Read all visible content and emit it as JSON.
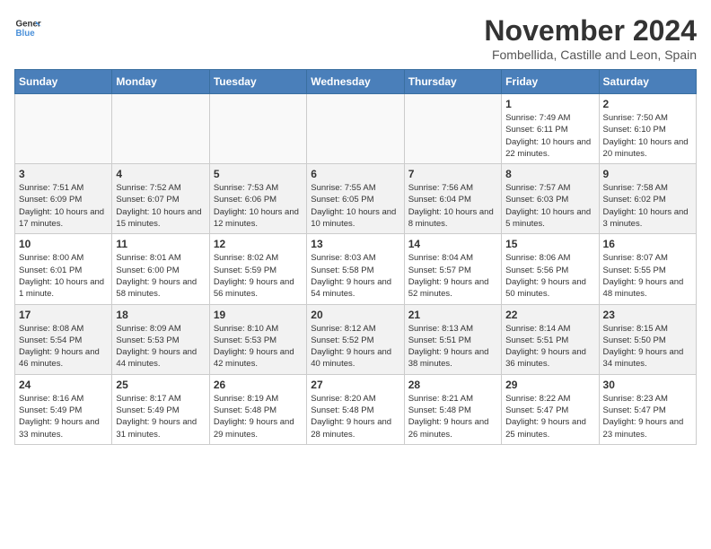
{
  "header": {
    "logo_line1": "General",
    "logo_line2": "Blue",
    "month": "November 2024",
    "location": "Fombellida, Castille and Leon, Spain"
  },
  "weekdays": [
    "Sunday",
    "Monday",
    "Tuesday",
    "Wednesday",
    "Thursday",
    "Friday",
    "Saturday"
  ],
  "weeks": [
    [
      {
        "day": "",
        "info": ""
      },
      {
        "day": "",
        "info": ""
      },
      {
        "day": "",
        "info": ""
      },
      {
        "day": "",
        "info": ""
      },
      {
        "day": "",
        "info": ""
      },
      {
        "day": "1",
        "info": "Sunrise: 7:49 AM\nSunset: 6:11 PM\nDaylight: 10 hours and 22 minutes."
      },
      {
        "day": "2",
        "info": "Sunrise: 7:50 AM\nSunset: 6:10 PM\nDaylight: 10 hours and 20 minutes."
      }
    ],
    [
      {
        "day": "3",
        "info": "Sunrise: 7:51 AM\nSunset: 6:09 PM\nDaylight: 10 hours and 17 minutes."
      },
      {
        "day": "4",
        "info": "Sunrise: 7:52 AM\nSunset: 6:07 PM\nDaylight: 10 hours and 15 minutes."
      },
      {
        "day": "5",
        "info": "Sunrise: 7:53 AM\nSunset: 6:06 PM\nDaylight: 10 hours and 12 minutes."
      },
      {
        "day": "6",
        "info": "Sunrise: 7:55 AM\nSunset: 6:05 PM\nDaylight: 10 hours and 10 minutes."
      },
      {
        "day": "7",
        "info": "Sunrise: 7:56 AM\nSunset: 6:04 PM\nDaylight: 10 hours and 8 minutes."
      },
      {
        "day": "8",
        "info": "Sunrise: 7:57 AM\nSunset: 6:03 PM\nDaylight: 10 hours and 5 minutes."
      },
      {
        "day": "9",
        "info": "Sunrise: 7:58 AM\nSunset: 6:02 PM\nDaylight: 10 hours and 3 minutes."
      }
    ],
    [
      {
        "day": "10",
        "info": "Sunrise: 8:00 AM\nSunset: 6:01 PM\nDaylight: 10 hours and 1 minute."
      },
      {
        "day": "11",
        "info": "Sunrise: 8:01 AM\nSunset: 6:00 PM\nDaylight: 9 hours and 58 minutes."
      },
      {
        "day": "12",
        "info": "Sunrise: 8:02 AM\nSunset: 5:59 PM\nDaylight: 9 hours and 56 minutes."
      },
      {
        "day": "13",
        "info": "Sunrise: 8:03 AM\nSunset: 5:58 PM\nDaylight: 9 hours and 54 minutes."
      },
      {
        "day": "14",
        "info": "Sunrise: 8:04 AM\nSunset: 5:57 PM\nDaylight: 9 hours and 52 minutes."
      },
      {
        "day": "15",
        "info": "Sunrise: 8:06 AM\nSunset: 5:56 PM\nDaylight: 9 hours and 50 minutes."
      },
      {
        "day": "16",
        "info": "Sunrise: 8:07 AM\nSunset: 5:55 PM\nDaylight: 9 hours and 48 minutes."
      }
    ],
    [
      {
        "day": "17",
        "info": "Sunrise: 8:08 AM\nSunset: 5:54 PM\nDaylight: 9 hours and 46 minutes."
      },
      {
        "day": "18",
        "info": "Sunrise: 8:09 AM\nSunset: 5:53 PM\nDaylight: 9 hours and 44 minutes."
      },
      {
        "day": "19",
        "info": "Sunrise: 8:10 AM\nSunset: 5:53 PM\nDaylight: 9 hours and 42 minutes."
      },
      {
        "day": "20",
        "info": "Sunrise: 8:12 AM\nSunset: 5:52 PM\nDaylight: 9 hours and 40 minutes."
      },
      {
        "day": "21",
        "info": "Sunrise: 8:13 AM\nSunset: 5:51 PM\nDaylight: 9 hours and 38 minutes."
      },
      {
        "day": "22",
        "info": "Sunrise: 8:14 AM\nSunset: 5:51 PM\nDaylight: 9 hours and 36 minutes."
      },
      {
        "day": "23",
        "info": "Sunrise: 8:15 AM\nSunset: 5:50 PM\nDaylight: 9 hours and 34 minutes."
      }
    ],
    [
      {
        "day": "24",
        "info": "Sunrise: 8:16 AM\nSunset: 5:49 PM\nDaylight: 9 hours and 33 minutes."
      },
      {
        "day": "25",
        "info": "Sunrise: 8:17 AM\nSunset: 5:49 PM\nDaylight: 9 hours and 31 minutes."
      },
      {
        "day": "26",
        "info": "Sunrise: 8:19 AM\nSunset: 5:48 PM\nDaylight: 9 hours and 29 minutes."
      },
      {
        "day": "27",
        "info": "Sunrise: 8:20 AM\nSunset: 5:48 PM\nDaylight: 9 hours and 28 minutes."
      },
      {
        "day": "28",
        "info": "Sunrise: 8:21 AM\nSunset: 5:48 PM\nDaylight: 9 hours and 26 minutes."
      },
      {
        "day": "29",
        "info": "Sunrise: 8:22 AM\nSunset: 5:47 PM\nDaylight: 9 hours and 25 minutes."
      },
      {
        "day": "30",
        "info": "Sunrise: 8:23 AM\nSunset: 5:47 PM\nDaylight: 9 hours and 23 minutes."
      }
    ]
  ]
}
